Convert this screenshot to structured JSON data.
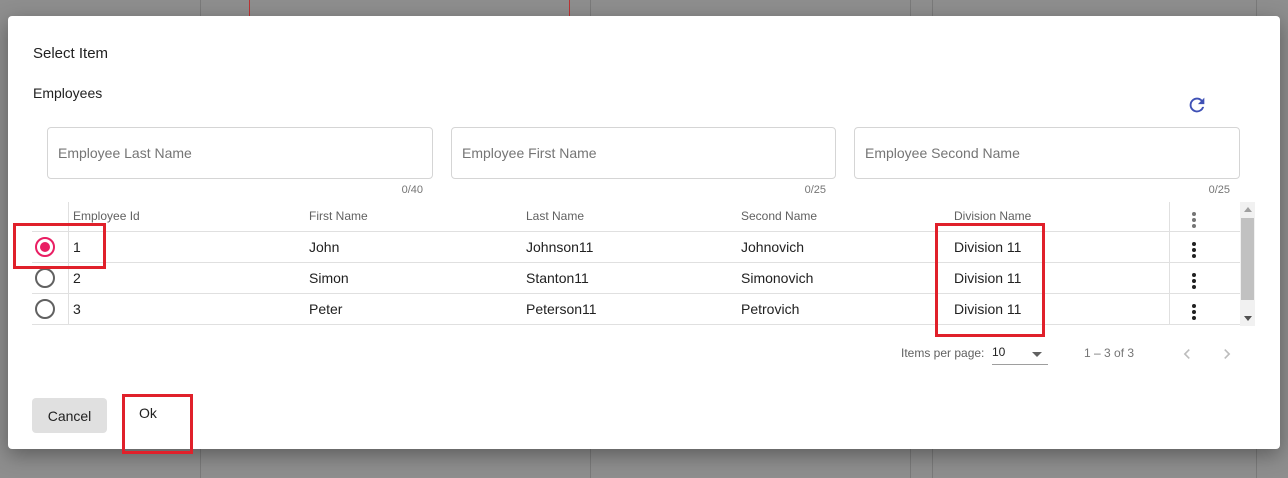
{
  "dialog": {
    "title": "Select Item",
    "section": "Employees"
  },
  "filters": [
    {
      "placeholder": "Employee Last Name",
      "value": "",
      "counter": "0/40"
    },
    {
      "placeholder": "Employee First Name",
      "value": "",
      "counter": "0/25"
    },
    {
      "placeholder": "Employee Second Name",
      "value": "",
      "counter": "0/25"
    }
  ],
  "table": {
    "columns": [
      "Employee Id",
      "First Name",
      "Last Name",
      "Second Name",
      "Division Name"
    ],
    "rows": [
      {
        "selected": true,
        "id": "1",
        "first": "John",
        "last": "Johnson11",
        "second": "Johnovich",
        "division": "Division 11"
      },
      {
        "selected": false,
        "id": "2",
        "first": "Simon",
        "last": "Stanton11",
        "second": "Simonovich",
        "division": "Division 11"
      },
      {
        "selected": false,
        "id": "3",
        "first": "Peter",
        "last": "Peterson11",
        "second": "Petrovich",
        "division": "Division 11"
      }
    ]
  },
  "paginator": {
    "items_per_page_label": "Items per page:",
    "page_size": "10",
    "range": "1 – 3 of 3"
  },
  "buttons": {
    "cancel": "Cancel",
    "ok": "Ok"
  },
  "colors": {
    "accent": "#e91e63",
    "refresh": "#3f51b5",
    "highlight": "#e0202a"
  },
  "icons": {
    "refresh": "refresh-icon",
    "row_menu": "more-vert-icon",
    "prev": "chevron-left-icon",
    "next": "chevron-right-icon",
    "dropdown": "caret-down-icon"
  }
}
